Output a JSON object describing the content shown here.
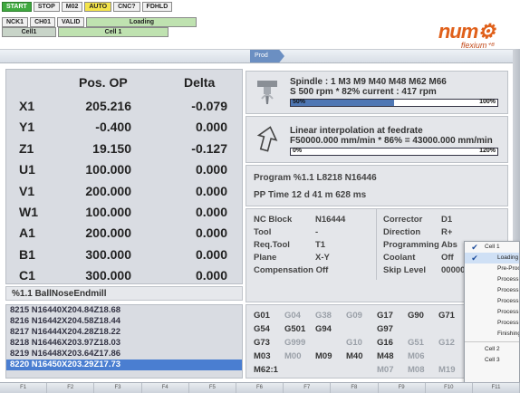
{
  "status_chips_row1": [
    "START",
    "STOP",
    "M02",
    "AUTO",
    "CNC?",
    "FDHLD"
  ],
  "status_chips_row2": [
    "NCK1",
    "CH01",
    "VALID",
    "Loading"
  ],
  "status_chips_row3": [
    "Cell1",
    "Cell 1"
  ],
  "prod_tab": "Prod",
  "logo": {
    "num": "num",
    "flexium": "flexium⁺⁸"
  },
  "coords": {
    "header_pos": "Pos. OP",
    "header_delta": "Delta",
    "rows": [
      {
        "axis": "X1",
        "pos": "205.216",
        "delta": "-0.079"
      },
      {
        "axis": "Y1",
        "pos": "-0.400",
        "delta": "0.000"
      },
      {
        "axis": "Z1",
        "pos": "19.150",
        "delta": "-0.127"
      },
      {
        "axis": "U1",
        "pos": "100.000",
        "delta": "0.000"
      },
      {
        "axis": "V1",
        "pos": "200.000",
        "delta": "0.000"
      },
      {
        "axis": "W1",
        "pos": "100.000",
        "delta": "0.000"
      },
      {
        "axis": "A1",
        "pos": "200.000",
        "delta": "0.000"
      },
      {
        "axis": "B1",
        "pos": "300.000",
        "delta": "0.000"
      },
      {
        "axis": "C1",
        "pos": "300.000",
        "delta": "0.000"
      }
    ]
  },
  "tool_name": "%1.1 BallNoseEndmill",
  "program_lines": [
    "8215 N16440X204.84Z18.68",
    "8216 N16442X204.58Z18.44",
    "8217 N16444X204.28Z18.22",
    "8218 N16446X203.97Z18.03",
    "8219 N16448X203.64Z17.86",
    "8220 N16450X203.29Z17.73"
  ],
  "spindle": {
    "line1": "Spindle : 1   M3 M9 M40 M48 M62 M66",
    "line2": "S 500 rpm * 82% current : 417 rpm",
    "bar_left": "50%",
    "bar_right": "100%",
    "bar_fill": 0.5
  },
  "feed": {
    "line1": "Linear interpolation at feedrate",
    "line2": "F50000.000 mm/min * 86% = 43000.000 mm/min",
    "bar_left": "0%",
    "bar_right": "120%",
    "bar_fill": 0.0
  },
  "program_info": {
    "program": "Program %1.1 L8218 N16446",
    "pp_time": "PP Time 12 d 41 m 628 ms"
  },
  "block_info": {
    "nc_block_label": "NC Block",
    "nc_block_value": "N16444",
    "tool_label": "Tool",
    "tool_value": "-",
    "req_tool_label": "Req.Tool",
    "req_tool_value": "T1",
    "plane_label": "Plane",
    "plane_value": "X-Y",
    "compensation": "Compensation Off",
    "corrector_label": "Corrector",
    "corrector_value": "D1",
    "direction_label": "Direction",
    "direction_value": "R+",
    "programming_label": "Programming",
    "programming_value": "Abs",
    "coolant_label": "Coolant",
    "coolant_value": "Off",
    "skip_label": "Skip Level",
    "skip_value": "00000"
  },
  "gcodes": {
    "row1": [
      {
        "t": "G01",
        "on": true
      },
      {
        "t": "G04",
        "on": false
      },
      {
        "t": "G38",
        "on": false
      },
      {
        "t": "G09",
        "on": false
      },
      {
        "t": "G17",
        "on": true
      },
      {
        "t": "G90",
        "on": true
      },
      {
        "t": "G71",
        "on": true
      },
      {
        "t": "G5",
        "on": false
      }
    ],
    "row2": [
      {
        "t": "G54",
        "on": true
      },
      {
        "t": "G501",
        "on": true
      },
      {
        "t": "G94",
        "on": true
      },
      {
        "t": "",
        "on": false
      },
      {
        "t": "G97",
        "on": true
      },
      {
        "t": "",
        "on": false
      },
      {
        "t": "",
        "on": false
      },
      {
        "t": "G2",
        "on": false
      }
    ],
    "row3": [
      {
        "t": "G73",
        "on": true
      },
      {
        "t": "G999",
        "on": false
      },
      {
        "t": "",
        "on": false
      },
      {
        "t": "G10",
        "on": false
      },
      {
        "t": "G16",
        "on": true
      },
      {
        "t": "G51",
        "on": false
      },
      {
        "t": "G12",
        "on": false
      },
      {
        "t": "G8",
        "on": true
      }
    ],
    "row4": [
      {
        "t": "M03",
        "on": true
      },
      {
        "t": "M00",
        "on": false
      },
      {
        "t": "M09",
        "on": true
      },
      {
        "t": "M40",
        "on": true
      },
      {
        "t": "M48",
        "on": true
      },
      {
        "t": "M06",
        "on": false
      },
      {
        "t": "",
        "on": false
      },
      {
        "t": "",
        "on": false
      }
    ],
    "row5": [
      {
        "t": "M62:1",
        "on": true
      },
      {
        "t": "",
        "on": false
      },
      {
        "t": "",
        "on": false
      },
      {
        "t": "",
        "on": false
      },
      {
        "t": "M07",
        "on": false
      },
      {
        "t": "M08",
        "on": false
      },
      {
        "t": "M19",
        "on": false
      },
      {
        "t": "",
        "on": false
      }
    ]
  },
  "menu": {
    "items": [
      {
        "label": "Cell 1",
        "checked": true,
        "sub": false,
        "sel": false
      },
      {
        "label": "Loading",
        "checked": true,
        "sub": true,
        "sel": true
      },
      {
        "label": "Pre-Proc",
        "checked": false,
        "sub": true,
        "sel": false
      },
      {
        "label": "Process",
        "checked": false,
        "sub": true,
        "sel": false
      },
      {
        "label": "Process 2",
        "checked": false,
        "sub": true,
        "sel": false
      },
      {
        "label": "Process 3",
        "checked": false,
        "sub": true,
        "sel": false
      },
      {
        "label": "Process 4",
        "checked": false,
        "sub": true,
        "sel": false
      },
      {
        "label": "Process 5",
        "checked": false,
        "sub": true,
        "sel": false
      },
      {
        "label": "Finishing",
        "checked": false,
        "sub": true,
        "sel": false
      },
      {
        "label": "Cell 2",
        "checked": false,
        "sub": false,
        "sel": false
      },
      {
        "label": "Cell 3",
        "checked": false,
        "sub": false,
        "sel": false
      }
    ]
  },
  "softkeys": [
    "F1",
    "F2",
    "F3",
    "F4",
    "F5",
    "F6",
    "F7",
    "F8",
    "F9",
    "F10",
    "F11"
  ]
}
